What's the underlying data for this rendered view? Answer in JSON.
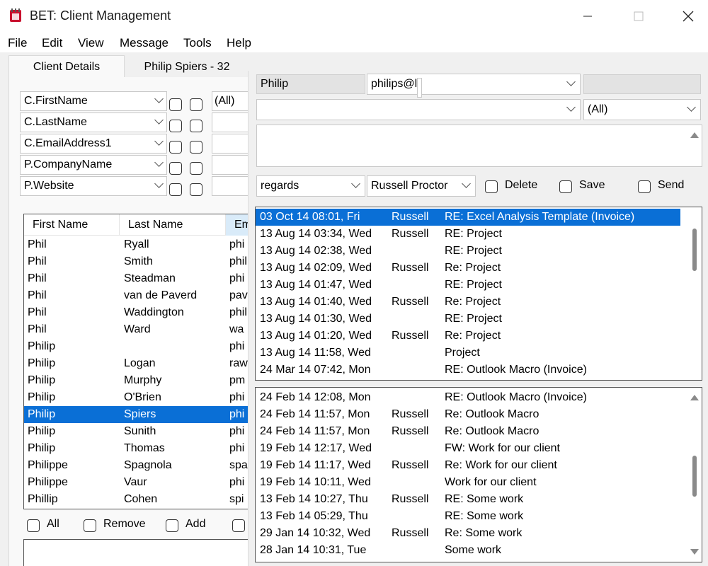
{
  "window": {
    "title": "BET: Client Management"
  },
  "menu": [
    "File",
    "Edit",
    "View",
    "Message",
    "Tools",
    "Help"
  ],
  "tabs": [
    {
      "label": "Client Details",
      "active": true
    },
    {
      "label": "Philip Spiers - 32",
      "active": false
    }
  ],
  "filters": [
    {
      "field": "C.FirstName",
      "value": "(All)"
    },
    {
      "field": "C.LastName",
      "value": ""
    },
    {
      "field": "C.EmailAddress1",
      "value": ""
    },
    {
      "field": "P.CompanyName",
      "value": ""
    },
    {
      "field": "P.Website",
      "value": ""
    }
  ],
  "client_list": {
    "columns": [
      "First Name",
      "Last Name",
      "Em"
    ],
    "rows": [
      {
        "first": "Phil",
        "last": "Ryall",
        "email": "phi"
      },
      {
        "first": "Phil",
        "last": "Smith",
        "email": "phil"
      },
      {
        "first": "Phil",
        "last": "Steadman",
        "email": "phi"
      },
      {
        "first": "Phil",
        "last": "van de Paverd",
        "email": "pav"
      },
      {
        "first": "Phil",
        "last": "Waddington",
        "email": "phil"
      },
      {
        "first": "Phil",
        "last": "Ward",
        "email": "wa"
      },
      {
        "first": "Philip",
        "last": "",
        "email": "phi"
      },
      {
        "first": "Philip",
        "last": "Logan",
        "email": "raw"
      },
      {
        "first": "Philip",
        "last": "Murphy",
        "email": "pm"
      },
      {
        "first": "Philip",
        "last": "O'Brien",
        "email": "phi"
      },
      {
        "first": "Philip",
        "last": "Spiers",
        "email": "phi",
        "selected": true
      },
      {
        "first": "Philip",
        "last": "Sunith",
        "email": "phi"
      },
      {
        "first": "Philip",
        "last": "Thomas",
        "email": "phi"
      },
      {
        "first": "Philippe",
        "last": "Spagnola",
        "email": "spa"
      },
      {
        "first": "Philippe",
        "last": "Vaur",
        "email": "phi"
      },
      {
        "first": "Phillip",
        "last": "Cohen",
        "email": "spi"
      }
    ]
  },
  "bottom_actions": {
    "all": "All",
    "remove": "Remove",
    "add": "Add"
  },
  "right": {
    "contact_name": "Philip",
    "email_filter": "philips@l",
    "extra": "",
    "subject_combo": "",
    "subject_filter": "(All)",
    "signature": "regards",
    "sender": "Russell Proctor",
    "delete_label": "Delete",
    "save_label": "Save",
    "send_label": "Send"
  },
  "messages_top": [
    {
      "date": "03 Oct 14 08:01, Fri",
      "from": "Russell",
      "subject": "RE: Excel Analysis Template (Invoice)",
      "selected": true
    },
    {
      "date": "13 Aug 14 03:34, Wed",
      "from": "Russell",
      "subject": "RE: Project"
    },
    {
      "date": "13 Aug 14 02:38, Wed",
      "from": "",
      "subject": "RE: Project"
    },
    {
      "date": "13 Aug 14 02:09, Wed",
      "from": "Russell",
      "subject": "Re: Project"
    },
    {
      "date": "13 Aug 14 01:47, Wed",
      "from": "",
      "subject": "RE: Project"
    },
    {
      "date": "13 Aug 14 01:40, Wed",
      "from": "Russell",
      "subject": "Re: Project"
    },
    {
      "date": "13 Aug 14 01:30, Wed",
      "from": "",
      "subject": "RE: Project"
    },
    {
      "date": "13 Aug 14 01:20, Wed",
      "from": "Russell",
      "subject": "Re: Project"
    },
    {
      "date": "13 Aug 14 11:58, Wed",
      "from": "",
      "subject": "Project"
    },
    {
      "date": "24 Mar 14 07:42, Mon",
      "from": "",
      "subject": "RE: Outlook Macro (Invoice)"
    }
  ],
  "messages_bottom": [
    {
      "date": "24 Feb 14 12:08, Mon",
      "from": "",
      "subject": "RE: Outlook Macro (Invoice)"
    },
    {
      "date": "24 Feb 14 11:57, Mon",
      "from": "Russell",
      "subject": "Re: Outlook Macro"
    },
    {
      "date": "24 Feb 14 11:57, Mon",
      "from": "Russell",
      "subject": "Re: Outlook Macro"
    },
    {
      "date": "19 Feb 14 12:17, Wed",
      "from": "",
      "subject": "FW: Work for our client"
    },
    {
      "date": "19 Feb 14 11:17, Wed",
      "from": "Russell",
      "subject": "Re: Work for our client"
    },
    {
      "date": "19 Feb 14 10:11, Wed",
      "from": "",
      "subject": "Work for our client"
    },
    {
      "date": "13 Feb 14 10:27, Thu",
      "from": "Russell",
      "subject": "RE: Some work"
    },
    {
      "date": "13 Feb 14 05:29, Thu",
      "from": "",
      "subject": "RE: Some work"
    },
    {
      "date": "29 Jan 14 10:32, Wed",
      "from": "Russell",
      "subject": "Re: Some work"
    },
    {
      "date": "28 Jan 14 10:31, Tue",
      "from": "",
      "subject": "Some work"
    }
  ],
  "colors": {
    "selection": "#0a6fd6",
    "accent_icon": "#c8102e"
  },
  "icons": [
    "app-icon",
    "minimize-icon",
    "maximize-icon",
    "close-icon",
    "chevron-down-icon",
    "scroll-up-icon",
    "scroll-down-icon"
  ]
}
